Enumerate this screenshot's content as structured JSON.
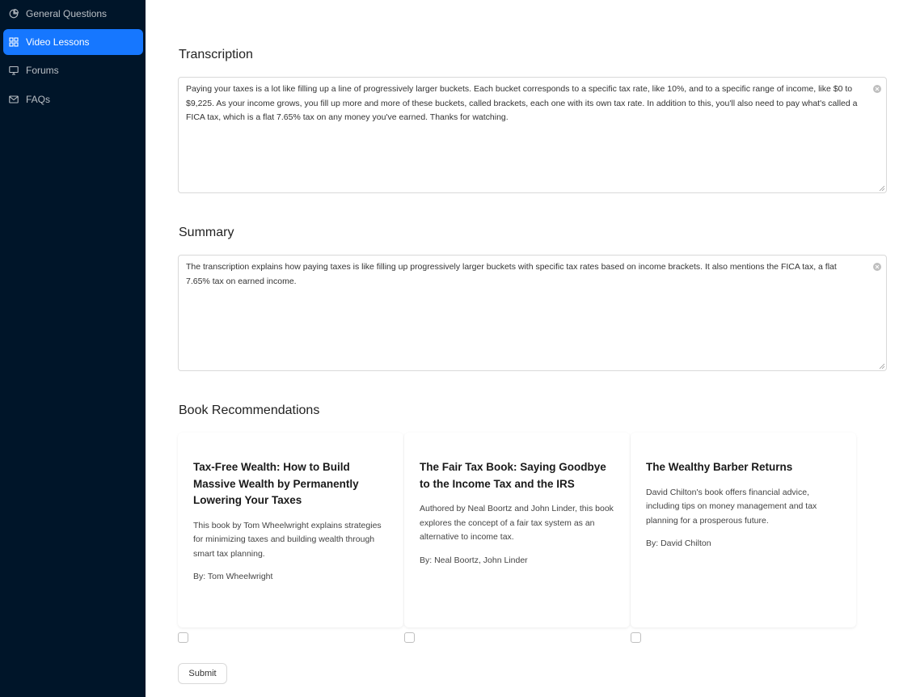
{
  "sidebar": {
    "items": [
      {
        "label": "General Questions",
        "icon": "pie-chart-icon",
        "active": false
      },
      {
        "label": "Video Lessons",
        "icon": "grid-icon",
        "active": true
      },
      {
        "label": "Forums",
        "icon": "desktop-icon",
        "active": false
      },
      {
        "label": "FAQs",
        "icon": "mail-icon",
        "active": false
      }
    ],
    "background": "#001529",
    "active_color": "#1677ff"
  },
  "transcription": {
    "title": "Transcription",
    "text": "Paying your taxes is a lot like filling up a line of progressively larger buckets. Each bucket corresponds to a specific tax rate, like 10%, and to a specific range of income, like $0 to $9,225. As your income grows, you fill up more and more of these buckets, called brackets, each one with its own tax rate. In addition to this, you'll also need to pay what's called a FICA tax, which is a flat 7.65% tax on any money you've earned. Thanks for watching."
  },
  "summary": {
    "title": "Summary",
    "text": "The transcription explains how paying taxes is like filling up progressively larger buckets with specific tax rates based on income brackets. It also mentions the FICA tax, a flat 7.65% tax on earned income."
  },
  "books": {
    "title": "Book Recommendations",
    "items": [
      {
        "title": "Tax-Free Wealth: How to Build Massive Wealth by Permanently Lowering Your Taxes",
        "description": "This book by Tom Wheelwright explains strategies for minimizing taxes and building wealth through smart tax planning.",
        "author": "By: Tom Wheelwright",
        "checked": false
      },
      {
        "title": "The Fair Tax Book: Saying Goodbye to the Income Tax and the IRS",
        "description": "Authored by Neal Boortz and John Linder, this book explores the concept of a fair tax system as an alternative to income tax.",
        "author": "By: Neal Boortz, John Linder",
        "checked": false
      },
      {
        "title": "The Wealthy Barber Returns",
        "description": "David Chilton's book offers financial advice, including tips on money management and tax planning for a prosperous future.",
        "author": "By: David Chilton",
        "checked": false
      }
    ]
  },
  "submit": {
    "label": "Submit"
  }
}
